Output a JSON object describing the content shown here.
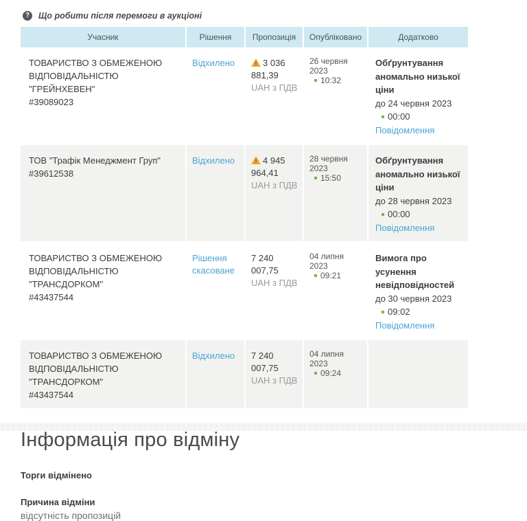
{
  "icons": {
    "help_glyph": "?"
  },
  "help": {
    "text": "Що робити після перемоги в аукціоні"
  },
  "table": {
    "headers": [
      "Учасник",
      "Рішення",
      "Пропозиція",
      "Опубліковано",
      "Додатково"
    ],
    "rows": [
      {
        "participant_name": "ТОВАРИСТВО З ОБМЕЖЕНОЮ ВІДПОВІДАЛЬНІСТЮ \"ГРЕЙНХЕВЕН\"",
        "participant_id": "#39089023",
        "decision": "Відхилено",
        "proposal_amount": "3 036 881,39",
        "proposal_currency": "UAH з ПДВ",
        "published_date": "26 червня 2023",
        "published_time": "10:32",
        "extra": {
          "title": "Обґрунтування аномально низької ціни",
          "deadline_date": "до 24 червня 2023",
          "deadline_time": "00:00",
          "link": "Повідомлення"
        }
      },
      {
        "participant_name": "ТОВ \"Трафік Менеджмент Груп\"",
        "participant_id": "#39612538",
        "decision": "Відхилено",
        "proposal_amount": "4 945 964,41",
        "proposal_currency": "UAH з ПДВ",
        "published_date": "28 червня 2023",
        "published_time": "15:50",
        "extra": {
          "title": "Обґрунтування аномально низької ціни",
          "deadline_date": "до 28 червня 2023",
          "deadline_time": "00:00",
          "link": "Повідомлення"
        }
      },
      {
        "participant_name": "ТОВАРИСТВО З ОБМЕЖЕНОЮ ВІДПОВІДАЛЬНІСТЮ \"ТРАНСДОРКОМ\"",
        "participant_id": "#43437544",
        "decision": "Рішення скасоване",
        "proposal_amount": "7 240 007,75",
        "proposal_currency": "UAH з ПДВ",
        "published_date": "04 липня 2023",
        "published_time": "09:21",
        "extra": {
          "title": "Вимога про усунення невідповідностей",
          "deadline_date": "до 30 червня 2023",
          "deadline_time": "09:02",
          "link": "Повідомлення"
        }
      },
      {
        "participant_name": "ТОВАРИСТВО З ОБМЕЖЕНОЮ ВІДПОВІДАЛЬНІСТЮ \"ТРАНСДОРКОМ\"",
        "participant_id": "#43437544",
        "decision": "Відхилено",
        "proposal_amount": "7 240 007,75",
        "proposal_currency": "UAH з ПДВ",
        "published_date": "04 липня 2023",
        "published_time": "09:24"
      }
    ]
  },
  "cancellation": {
    "title": "Інформація про відміну",
    "status": "Торги відмінено",
    "reason_label": "Причина відміни",
    "reason_value": "відсутність пропозицій"
  },
  "colors": {
    "link_blue": "#4aa3d5",
    "header_bg": "#cfe9f2",
    "row_alt_bg": "#f2f3f0",
    "warning_orange": "#f0a733",
    "bullet_green": "#76b84e"
  }
}
